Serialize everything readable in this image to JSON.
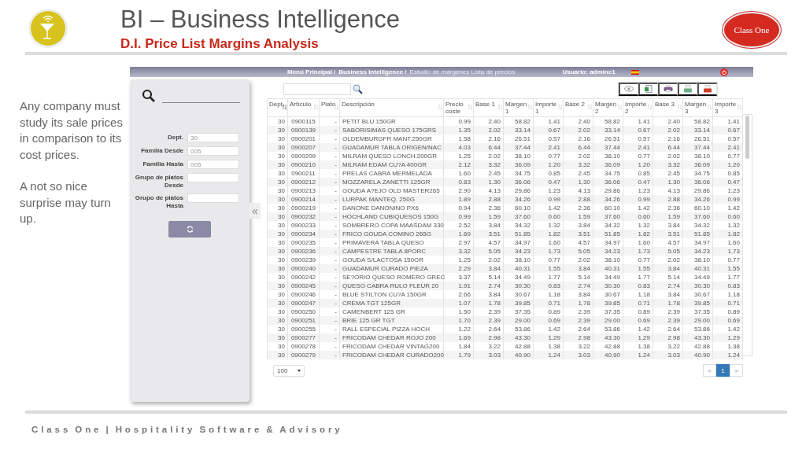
{
  "header": {
    "title": "BI – Business Intelligence",
    "subtitle": "D.I. Price List Margins Analysis",
    "brand_logo": "Class One"
  },
  "intro": [
    "Any company must study its sale prices in comparison to its cost prices.",
    "A not so nice surprise may turn up."
  ],
  "app": {
    "breadcrumb": [
      "Menú Principal /",
      "Business Intelligence /",
      "Estudio de márgenes Lista de precios"
    ],
    "user": "Usuario: adminc1",
    "filters": [
      {
        "label": "Dept.",
        "placeholder": "30"
      },
      {
        "label": "Familia Desde",
        "placeholder": "005"
      },
      {
        "label": "Familia Hasta",
        "placeholder": "005"
      },
      {
        "label": "Grupo de platos Desde"
      },
      {
        "label": "Grupo de platos Hasta"
      }
    ],
    "collapse": "«",
    "table": {
      "columns": [
        {
          "label": "Dept.",
          "sorted": true
        },
        {
          "label": "Artículo",
          "sorted": false
        },
        {
          "label": "Plato",
          "sorted": false
        },
        {
          "label": "Descripción",
          "sorted": false
        },
        {
          "label": "Precio coste",
          "sorted": false
        },
        {
          "label": "Base 1",
          "sorted": false
        },
        {
          "label": "Margen 1",
          "sorted": false
        },
        {
          "label": "Importe 1",
          "sorted": false
        },
        {
          "label": "Base 2",
          "sorted": false
        },
        {
          "label": "Margen 2",
          "sorted": false
        },
        {
          "label": "Importe 2",
          "sorted": false
        },
        {
          "label": "Base 3",
          "sorted": false
        },
        {
          "label": "Margen 3",
          "sorted": false
        },
        {
          "label": "Importe 3",
          "sorted": false
        }
      ],
      "rows": [
        [
          "30",
          "0900115",
          "-",
          "PETIT BLU 150GR",
          "0.99",
          "2.40",
          "58.82",
          "1.41",
          "2.40",
          "58.82",
          "1.41",
          "2.40",
          "58.82",
          "1.41"
        ],
        [
          "30",
          "0900139",
          "-",
          "SABORISIMAS QUESO 175GRS",
          "1.35",
          "2.02",
          "33.14",
          "0.67",
          "2.02",
          "33.14",
          "0.67",
          "2.02",
          "33.14",
          "0.67"
        ],
        [
          "30",
          "0900201",
          "-",
          "OLDEMBURGFR MANT.250GR",
          "1.58",
          "2.16",
          "26.51",
          "0.57",
          "2.16",
          "26.51",
          "0.57",
          "2.16",
          "26.51",
          "0.57"
        ],
        [
          "30",
          "0900207",
          "-",
          "GUADAMUR TABLA ORIGEN/NAC",
          "4.03",
          "6.44",
          "37.44",
          "2.41",
          "6.44",
          "37.44",
          "2.41",
          "6.44",
          "37.44",
          "2.41"
        ],
        [
          "30",
          "0900209",
          "-",
          "MILRAM QUESO LONCH.200GR",
          "1.25",
          "2.02",
          "38.10",
          "0.77",
          "2.02",
          "38.10",
          "0.77",
          "2.02",
          "38.10",
          "0.77"
        ],
        [
          "30",
          "0900210",
          "-",
          "MILRAM EDAM CU?A 400GR",
          "2.12",
          "3.32",
          "36.09",
          "1.20",
          "3.32",
          "36.09",
          "1.20",
          "3.32",
          "36.09",
          "1.20"
        ],
        [
          "30",
          "0900211",
          "-",
          "PRELAS CABRA MERMELADA",
          "1.60",
          "2.45",
          "34.75",
          "0.85",
          "2.45",
          "34.75",
          "0.85",
          "2.45",
          "34.75",
          "0.85"
        ],
        [
          "30",
          "0900212",
          "-",
          "MOZZARELA ZANETTI 125GR",
          "0.83",
          "1.30",
          "36.06",
          "0.47",
          "1.30",
          "36.06",
          "0.47",
          "1.30",
          "36.06",
          "0.47"
        ],
        [
          "30",
          "0900213",
          "-",
          "GOUDA A?EJO OLD MASTER265",
          "2.90",
          "4.13",
          "29.86",
          "1.23",
          "4.13",
          "29.86",
          "1.23",
          "4.13",
          "29.86",
          "1.23"
        ],
        [
          "30",
          "0900214",
          "-",
          "LURPAK MANTEQ. 250G",
          "1.89",
          "2.88",
          "34.26",
          "0.99",
          "2.88",
          "34.26",
          "0.99",
          "2.88",
          "34.26",
          "0.99"
        ],
        [
          "30",
          "0900219",
          "-",
          "DANONE DANONINO PX6",
          "0.94",
          "2.36",
          "60.10",
          "1.42",
          "2.36",
          "60.10",
          "1.42",
          "2.36",
          "60.10",
          "1.42"
        ],
        [
          "30",
          "0900232",
          "-",
          "HOCHLAND CUBIQUESOS 150G",
          "0.99",
          "1.59",
          "37.60",
          "0.60",
          "1.59",
          "37.60",
          "0.60",
          "1.59",
          "37.60",
          "0.60"
        ],
        [
          "30",
          "0900233",
          "-",
          "SOMBRERO COPA MAASDAM 330",
          "2.52",
          "3.84",
          "34.32",
          "1.32",
          "3.84",
          "34.32",
          "1.32",
          "3.84",
          "34.32",
          "1.32"
        ],
        [
          "30",
          "0900234",
          "-",
          "FRICO GOUDA COMINO 265G",
          "1.69",
          "3.51",
          "51.85",
          "1.82",
          "3.51",
          "51.85",
          "1.82",
          "3.51",
          "51.85",
          "1.82"
        ],
        [
          "30",
          "0900235",
          "-",
          "PRIMAVERA TABLA QUESO",
          "2.97",
          "4.57",
          "34.97",
          "1.60",
          "4.57",
          "34.97",
          "1.60",
          "4.57",
          "34.97",
          "1.60"
        ],
        [
          "30",
          "0900236",
          "-",
          "CAMPESTRE TABLA 8PORC",
          "3.32",
          "5.05",
          "34.23",
          "1.73",
          "5.05",
          "34.23",
          "1.73",
          "5.05",
          "34.23",
          "1.73"
        ],
        [
          "30",
          "0900239",
          "-",
          "GOUDA S/LACTOSA 150GR",
          "1.25",
          "2.02",
          "38.10",
          "0.77",
          "2.02",
          "38.10",
          "0.77",
          "2.02",
          "38.10",
          "0.77"
        ],
        [
          "30",
          "0900240",
          "-",
          "GUADAMUR CURADO PIEZA",
          "2.29",
          "3.84",
          "40.31",
          "1.55",
          "3.84",
          "40.31",
          "1.55",
          "3.84",
          "40.31",
          "1.55"
        ],
        [
          "30",
          "0900242",
          "-",
          "SE?ORIO QUESO ROMERO GREC",
          "3.37",
          "5.14",
          "34.49",
          "1.77",
          "5.14",
          "34.49",
          "1.77",
          "5.14",
          "34.49",
          "1.77"
        ],
        [
          "30",
          "0900245",
          "-",
          "QUESO CABRA RULO FLEUR 20",
          "1.91",
          "2.74",
          "30.30",
          "0.83",
          "2.74",
          "30.30",
          "0.83",
          "2.74",
          "30.30",
          "0.83"
        ],
        [
          "30",
          "0900246",
          "-",
          "BLUE STILTON CU?A 150GR",
          "2.66",
          "3.84",
          "30.67",
          "1.18",
          "3.84",
          "30.67",
          "1.18",
          "3.84",
          "30.67",
          "1.18"
        ],
        [
          "30",
          "0900247",
          "-",
          "CREMA TGT 125GR",
          "1.07",
          "1.78",
          "39.85",
          "0.71",
          "1.78",
          "39.85",
          "0.71",
          "1.78",
          "39.85",
          "0.71"
        ],
        [
          "30",
          "0900250",
          "-",
          "CAMENBERT 125 GR",
          "1.50",
          "2.39",
          "37.35",
          "0.89",
          "2.39",
          "37.35",
          "0.89",
          "2.39",
          "37.35",
          "0.89"
        ],
        [
          "30",
          "0900251",
          "-",
          "BRIE 125 GR TGT",
          "1.70",
          "2.39",
          "29.00",
          "0.69",
          "2.39",
          "29.00",
          "0.69",
          "2.39",
          "29.00",
          "0.69"
        ],
        [
          "30",
          "0900255",
          "-",
          "RALL ESPECIAL PIZZA HOCH",
          "1.22",
          "2.64",
          "53.86",
          "1.42",
          "2.64",
          "53.86",
          "1.42",
          "2.64",
          "53.86",
          "1.42"
        ],
        [
          "30",
          "0900277",
          "-",
          "FRICODAM CHEDAR ROJO 200",
          "1.69",
          "2.98",
          "43.30",
          "1.29",
          "2.98",
          "43.30",
          "1.29",
          "2.98",
          "43.30",
          "1.29"
        ],
        [
          "30",
          "0900278",
          "-",
          "FRICODAM CHEDAR VINTAG200",
          "1.84",
          "3.22",
          "42.88",
          "1.38",
          "3.22",
          "42.88",
          "1.38",
          "3.22",
          "42.88",
          "1.38"
        ],
        [
          "30",
          "0900279",
          "-",
          "FRICODAM CHEDAR CURADO200",
          "1.79",
          "3.03",
          "40.90",
          "1.24",
          "3.03",
          "40.90",
          "1.24",
          "3.03",
          "40.90",
          "1.24"
        ]
      ]
    },
    "page_size": "100",
    "pagination": [
      {
        "label": "<",
        "selected": false
      },
      {
        "label": "1",
        "selected": true
      },
      {
        "label": ">",
        "selected": false
      }
    ]
  },
  "footer": "Class One | Hospitality Software & Advisory"
}
